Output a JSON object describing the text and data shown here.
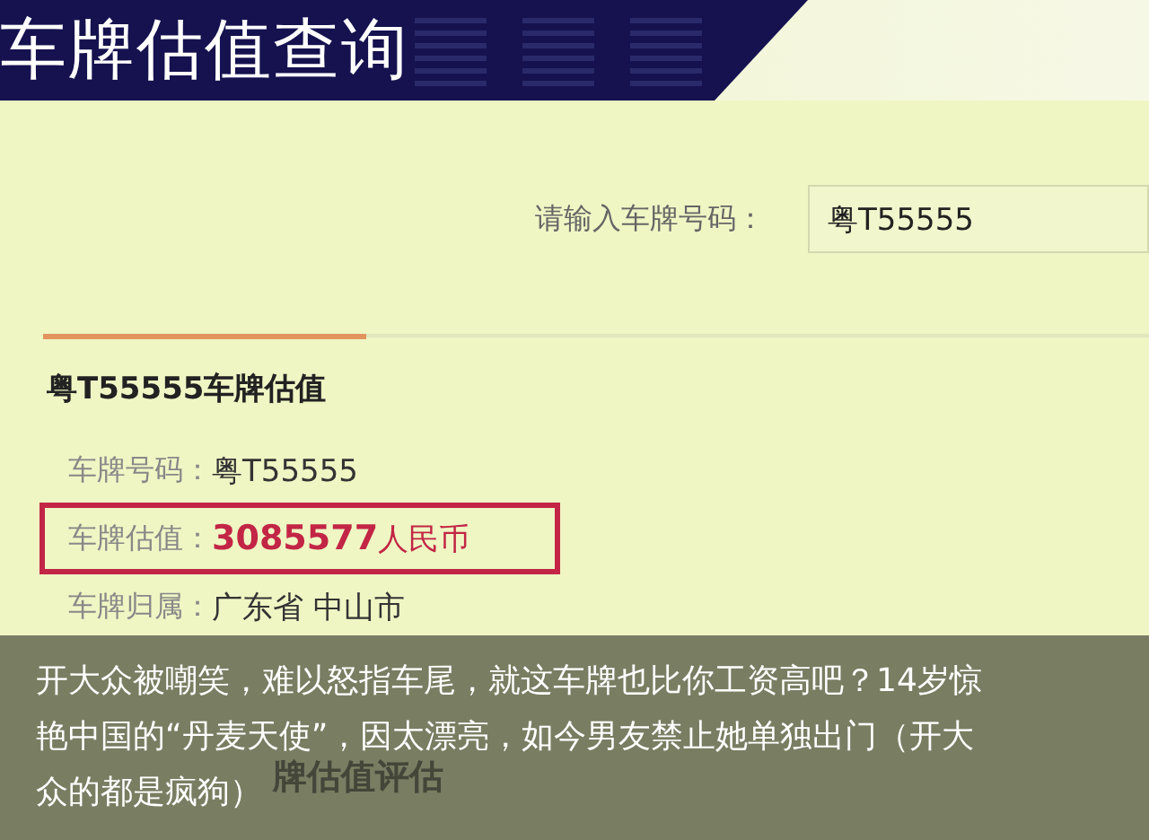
{
  "header": {
    "title": "车牌估值查询"
  },
  "search": {
    "label": "请输入车牌号码：",
    "value": "粤T55555"
  },
  "result": {
    "heading": "粤T55555车牌估值",
    "rows": [
      {
        "label": "车牌号码：",
        "value": "粤T55555",
        "highlighted": false
      },
      {
        "label": "车牌估值：",
        "value": "3085577",
        "unit": "人民币",
        "highlighted": true
      },
      {
        "label": "车牌归属：",
        "value": "广东省 中山市",
        "highlighted": false
      }
    ]
  },
  "next_section": {
    "heading": "牌估值评估"
  },
  "caption": {
    "lines": [
      "开大众被嘲笑，难以怒指车尾，就这车牌也比你工资高吧？14岁惊",
      "艳中国的“丹麦天使”，因太漂亮，如今男友禁止她单独出门（开大",
      "众的都是疯狗）"
    ]
  }
}
